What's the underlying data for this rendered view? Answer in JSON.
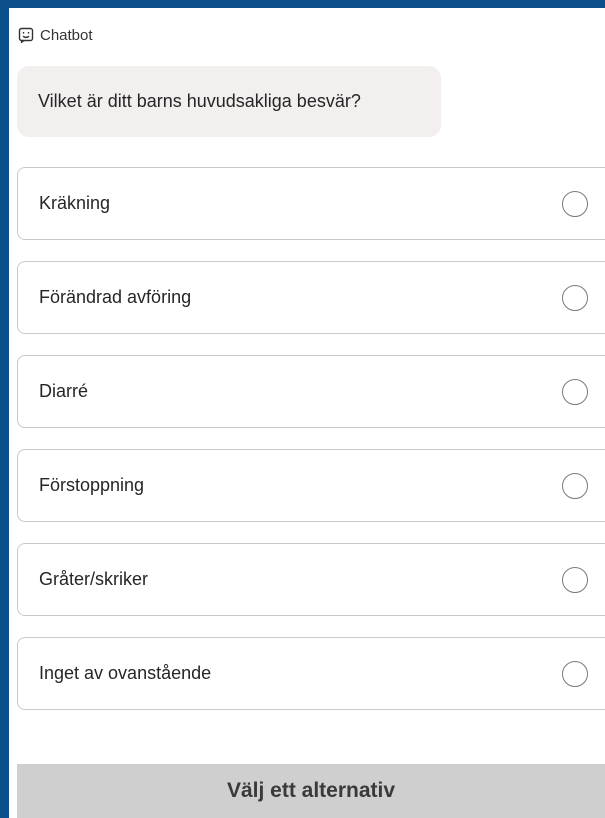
{
  "header": {
    "icon": "chatbot-face-icon",
    "label": "Chatbot"
  },
  "message": {
    "text": "Vilket är ditt barns huvudsakliga besvär?"
  },
  "options": [
    {
      "label": "Kräkning",
      "selected": false
    },
    {
      "label": "Förändrad avföring",
      "selected": false
    },
    {
      "label": "Diarré",
      "selected": false
    },
    {
      "label": "Förstoppning",
      "selected": false
    },
    {
      "label": "Gråter/skriker",
      "selected": false
    },
    {
      "label": "Inget av ovanstående",
      "selected": false
    }
  ],
  "submit": {
    "label": "Välj ett alternativ",
    "enabled": false
  },
  "colors": {
    "frame_border": "#0b4f8a",
    "bubble_bg": "#f2efee",
    "option_border": "#c9c9c9",
    "submit_bg": "#cfcfcf"
  }
}
